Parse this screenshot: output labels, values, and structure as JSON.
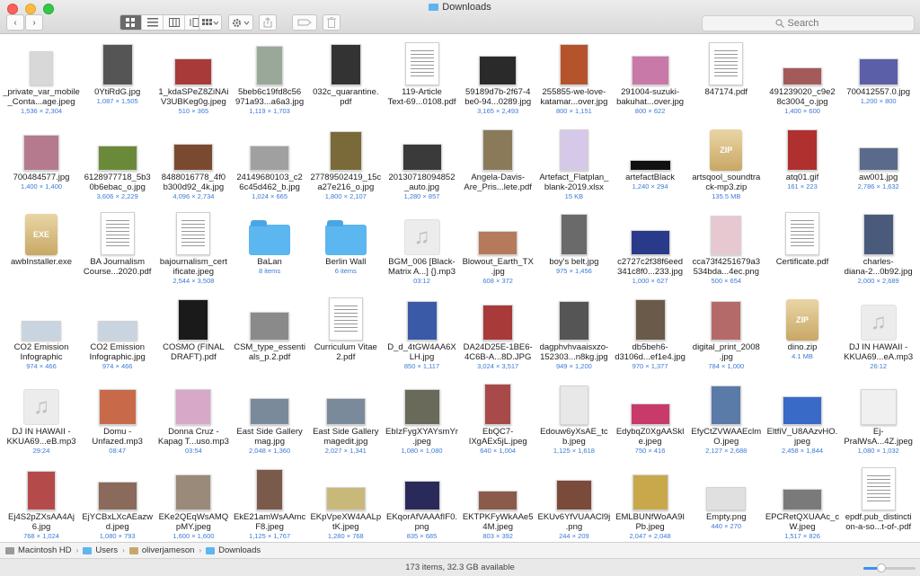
{
  "window": {
    "title": "Downloads",
    "accent": "#5cb6ef"
  },
  "toolbar": {
    "back": "‹",
    "forward": "›",
    "view_modes": [
      "icon-view-icon",
      "list-view-icon",
      "column-view-icon",
      "coverflow-view-icon"
    ],
    "arrange_icon": "grid-arrange-icon",
    "action_icon": "gear-icon",
    "share_icon": "share-icon",
    "tags_icon": "tag-icon",
    "trash_icon": "trash-icon",
    "search_placeholder": "Search"
  },
  "files": [
    {
      "name": "_private_var_mobile\n_Conta...age.jpeg",
      "meta": "1,536 × 2,304",
      "kind": "image",
      "w": 26,
      "h": 38,
      "color": "#d8d8d8"
    },
    {
      "name": "0YtiRdG.jpg",
      "meta": "1,087 × 1,505",
      "kind": "image",
      "w": 34,
      "h": 46,
      "color": "#555555"
    },
    {
      "name": "1_kdaSPeZ8ZiNAi\nV3UBKeg0g.jpeg",
      "meta": "510 × 365",
      "kind": "image",
      "w": 42,
      "h": 30,
      "color": "#a83a3a"
    },
    {
      "name": "5beb6c19fd8c56\n971a93...a6a3.jpg",
      "meta": "1,119 × 1,703",
      "kind": "image",
      "w": 30,
      "h": 44,
      "color": "#9aa89a"
    },
    {
      "name": "032c_quarantine.\npdf",
      "meta": "",
      "kind": "image",
      "w": 34,
      "h": 46,
      "color": "#333333"
    },
    {
      "name": "119-Article\nText-69...0108.pdf",
      "meta": "",
      "kind": "doc"
    },
    {
      "name": "59189d7b-2f67-4\nbe0-94...0289.jpg",
      "meta": "3,165 × 2,493",
      "kind": "image",
      "w": 42,
      "h": 33,
      "color": "#2a2a2a"
    },
    {
      "name": "255855-we-love-\nkatamar...over.jpg",
      "meta": "800 × 1,151",
      "kind": "image",
      "w": 32,
      "h": 46,
      "color": "#b5542c"
    },
    {
      "name": "291004-suzuki-\nbakuhat...over.jpg",
      "meta": "800 × 622",
      "kind": "image",
      "w": 42,
      "h": 33,
      "color": "#c879a8"
    },
    {
      "name": "847174.pdf",
      "meta": "",
      "kind": "doc"
    },
    {
      "name": "491239020_c9e2\n8c3004_o.jpg",
      "meta": "1,400 × 600",
      "kind": "image",
      "w": 44,
      "h": 20,
      "color": "#a55a5a"
    },
    {
      "name": "700412557.0.jpg",
      "meta": "1,200 × 800",
      "kind": "image",
      "w": 44,
      "h": 30,
      "color": "#5a5fa8"
    },
    {
      "name": "700484577.jpg",
      "meta": "1,400 × 1,400",
      "kind": "image",
      "w": 40,
      "h": 40,
      "color": "#b57a8e"
    },
    {
      "name": "6128977718_5b3\n0b6ebac_o.jpg",
      "meta": "3,606 × 2,229",
      "kind": "image",
      "w": 44,
      "h": 28,
      "color": "#6a8a3a"
    },
    {
      "name": "8488016778_4f0\nb300d92_4k.jpg",
      "meta": "4,096 × 2,734",
      "kind": "image",
      "w": 44,
      "h": 30,
      "color": "#7a4a30"
    },
    {
      "name": "24149680103_c2\n6c45d462_b.jpg",
      "meta": "1,024 × 665",
      "kind": "image",
      "w": 44,
      "h": 28,
      "color": "#a0a0a0"
    },
    {
      "name": "27789502419_15c\na27e216_o.jpg",
      "meta": "1,800 × 2,107",
      "kind": "image",
      "w": 36,
      "h": 44,
      "color": "#7a6a3a"
    },
    {
      "name": "20130718094852\n_auto.jpg",
      "meta": "1,280 × 857",
      "kind": "image",
      "w": 44,
      "h": 30,
      "color": "#3a3a3a"
    },
    {
      "name": "Angela-Davis-\nAre_Pris...lete.pdf",
      "meta": "",
      "kind": "image",
      "w": 34,
      "h": 46,
      "color": "#8a7a5a"
    },
    {
      "name": "Artefact_Flatplan_\nblank-2019.xlsx",
      "meta": "15 KB",
      "kind": "image",
      "w": 32,
      "h": 46,
      "color": "#d6c8e8"
    },
    {
      "name": "artefactBlack",
      "meta": "1,240 × 294",
      "kind": "image",
      "w": 46,
      "h": 12,
      "color": "#111111"
    },
    {
      "name": "artsqool_soundtra\nck-mp3.zip",
      "meta": "135.5 MB",
      "kind": "archive",
      "label": "ZIP"
    },
    {
      "name": "atq01.gif",
      "meta": "161 × 223",
      "kind": "image",
      "w": 34,
      "h": 46,
      "color": "#b03030"
    },
    {
      "name": "aw001.jpg",
      "meta": "2,786 × 1,632",
      "kind": "image",
      "w": 44,
      "h": 26,
      "color": "#5a6a8a"
    },
    {
      "name": "awbInstaller.exe",
      "meta": "",
      "kind": "archive",
      "label": "EXE"
    },
    {
      "name": "BA Journalism\nCourse...2020.pdf",
      "meta": "",
      "kind": "doc"
    },
    {
      "name": "bajournalism_cert\nificate.jpeg",
      "meta": "2,544 × 3,508",
      "kind": "doc"
    },
    {
      "name": "BaLan",
      "meta": "8 items",
      "kind": "folder"
    },
    {
      "name": "Berlin Wall",
      "meta": "6 items",
      "kind": "folder"
    },
    {
      "name": "BGM_006 [Black-\nMatrix A...] {}.mp3",
      "meta": "03:12",
      "kind": "audio"
    },
    {
      "name": "Blowout_Earth_TX\n.jpg",
      "meta": "608 × 372",
      "kind": "image",
      "w": 44,
      "h": 27,
      "color": "#b57a5a"
    },
    {
      "name": "boy's belt.jpg",
      "meta": "975 × 1,456",
      "kind": "image",
      "w": 30,
      "h": 46,
      "color": "#6a6a6a"
    },
    {
      "name": "c2727c2f38f6eed\n341c8f0...233.jpg",
      "meta": "1,000 × 627",
      "kind": "image",
      "w": 44,
      "h": 28,
      "color": "#2a3a8a"
    },
    {
      "name": "cca73f4251679a3\n534bda...4ec.png",
      "meta": "500 × 654",
      "kind": "image",
      "w": 34,
      "h": 44,
      "color": "#e8c8d0"
    },
    {
      "name": "Certificate.pdf",
      "meta": "",
      "kind": "doc"
    },
    {
      "name": "charles-\ndiana-2...0b92.jpg",
      "meta": "2,000 × 2,689",
      "kind": "image",
      "w": 34,
      "h": 46,
      "color": "#4a5a7a"
    },
    {
      "name": "CO2 Emission\nInfographic",
      "meta": "974 × 466",
      "kind": "image",
      "w": 44,
      "h": 22,
      "color": "#c8d4e0"
    },
    {
      "name": "CO2 Emission\nInfographic.jpg",
      "meta": "974 × 466",
      "kind": "image",
      "w": 44,
      "h": 22,
      "color": "#c8d4e0"
    },
    {
      "name": "COSMO (FINAL\nDRAFT).pdf",
      "meta": "",
      "kind": "image",
      "w": 34,
      "h": 46,
      "color": "#1a1a1a"
    },
    {
      "name": "CSM_type_essenti\nals_p.2.pdf",
      "meta": "",
      "kind": "image",
      "w": 44,
      "h": 32,
      "color": "#8a8a8a"
    },
    {
      "name": "Curriculum Vitae\n2.pdf",
      "meta": "",
      "kind": "doc"
    },
    {
      "name": "D_d_4tGW4AA6X\nLH.jpg",
      "meta": "850 × 1,117",
      "kind": "image",
      "w": 34,
      "h": 44,
      "color": "#3a5aa8"
    },
    {
      "name": "DA24D25E-1BE6-\n4C6B-A...8D.JPG",
      "meta": "3,024 × 3,517",
      "kind": "image",
      "w": 34,
      "h": 40,
      "color": "#a83a3a"
    },
    {
      "name": "dagphvhvaaisxzo-\n152303...n8kg.jpg",
      "meta": "949 × 1,200",
      "kind": "image",
      "w": 34,
      "h": 44,
      "color": "#555555"
    },
    {
      "name": "db5beh6-\nd3106d...ef1e4.jpg",
      "meta": "970 × 1,377",
      "kind": "image",
      "w": 34,
      "h": 46,
      "color": "#6a5a4a"
    },
    {
      "name": "digital_print_2008\n.jpg",
      "meta": "784 × 1,000",
      "kind": "image",
      "w": 34,
      "h": 44,
      "color": "#b56a6a"
    },
    {
      "name": "dino.zip",
      "meta": "4.1 MB",
      "kind": "archive",
      "label": "ZIP"
    },
    {
      "name": "DJ IN HAWAII -\nKKUA69...eA.mp3",
      "meta": "26:12",
      "kind": "audio"
    },
    {
      "name": "DJ IN HAWAII -\nKKUA69...eB.mp3",
      "meta": "29:24",
      "kind": "audio"
    },
    {
      "name": "Domu -\nUnfazed.mp3",
      "meta": "08:47",
      "kind": "image",
      "w": 42,
      "h": 40,
      "color": "#c86a4a"
    },
    {
      "name": "Donna Cruz -\nKapag T...uso.mp3",
      "meta": "03:54",
      "kind": "image",
      "w": 40,
      "h": 40,
      "color": "#d8a8c8"
    },
    {
      "name": "East Side Gallery\nmag.jpg",
      "meta": "2,048 × 1,360",
      "kind": "image",
      "w": 44,
      "h": 30,
      "color": "#7a8a9a"
    },
    {
      "name": "East Side Gallery\nmagedit.jpg",
      "meta": "2,027 × 1,341",
      "kind": "image",
      "w": 44,
      "h": 30,
      "color": "#7a8a9a"
    },
    {
      "name": "EbIzFygXYAYsmYr\n.jpeg",
      "meta": "1,080 × 1,080",
      "kind": "image",
      "w": 40,
      "h": 40,
      "color": "#6a6a5a"
    },
    {
      "name": "EbQC7-\nIXgAEx5jL.jpeg",
      "meta": "640 × 1,004",
      "kind": "image",
      "w": 30,
      "h": 46,
      "color": "#a84a4a"
    },
    {
      "name": "Edouw6yXsAE_tc\nb.jpeg",
      "meta": "1,125 × 1,618",
      "kind": "image",
      "w": 32,
      "h": 44,
      "color": "#e8e8e8"
    },
    {
      "name": "EdybqZ0XgAASkl\ne.jpeg",
      "meta": "750 × 416",
      "kind": "image",
      "w": 44,
      "h": 24,
      "color": "#c83a6a"
    },
    {
      "name": "EfyCtZVWAAEclm\nO.jpeg",
      "meta": "2,127 × 2,688",
      "kind": "image",
      "w": 34,
      "h": 44,
      "color": "#5a7aa8"
    },
    {
      "name": "EltfiV_U8AAzvHO.\njpeg",
      "meta": "2,458 × 1,844",
      "kind": "image",
      "w": 44,
      "h": 32,
      "color": "#3a6ac8"
    },
    {
      "name": "Ej-\nPralWsA...4Z.jpeg",
      "meta": "1,080 × 1,032",
      "kind": "image",
      "w": 40,
      "h": 40,
      "color": "#f0f0f0"
    },
    {
      "name": "Ej4S2pZXsAA4Aj\n6.jpg",
      "meta": "768 × 1,024",
      "kind": "image",
      "w": 32,
      "h": 44,
      "color": "#b54a4a"
    },
    {
      "name": "EjYCBxLXcAEazw\nd.jpeg",
      "meta": "1,080 × 793",
      "kind": "image",
      "w": 44,
      "h": 32,
      "color": "#8a6a5a"
    },
    {
      "name": "EKe2QEqWsAMQ\npMY.jpeg",
      "meta": "1,600 × 1,600",
      "kind": "image",
      "w": 40,
      "h": 40,
      "color": "#9a8a7a"
    },
    {
      "name": "EkE21amWsAAmc\nF8.jpeg",
      "meta": "1,125 × 1,767",
      "kind": "image",
      "w": 30,
      "h": 46,
      "color": "#7a5a4a"
    },
    {
      "name": "EKpVpeXW4AALp\ntK.jpeg",
      "meta": "1,280 × 768",
      "kind": "image",
      "w": 44,
      "h": 26,
      "color": "#c8b87a"
    },
    {
      "name": "EKqorAfVAAAfIF0.\npng",
      "meta": "835 × 685",
      "kind": "image",
      "w": 40,
      "h": 33,
      "color": "#2a2a5a"
    },
    {
      "name": "EKTPKFyWkAAe5\n4M.jpeg",
      "meta": "803 × 392",
      "kind": "image",
      "w": 44,
      "h": 22,
      "color": "#8a5a4a"
    },
    {
      "name": "EKUv6YfVUAACl9j\n.png",
      "meta": "244 × 209",
      "kind": "image",
      "w": 40,
      "h": 34,
      "color": "#7a4a3a"
    },
    {
      "name": "EMLBUNfWoAA9I\nPb.jpeg",
      "meta": "2,047 × 2,048",
      "kind": "image",
      "w": 40,
      "h": 40,
      "color": "#c8a84a"
    },
    {
      "name": "Empty.png",
      "meta": "440 × 270",
      "kind": "image",
      "w": 44,
      "h": 26,
      "color": "#e0e0e0"
    },
    {
      "name": "EPCRetQXUAAc_c\nW.jpeg",
      "meta": "1,517 × 826",
      "kind": "image",
      "w": 44,
      "h": 24,
      "color": "#7a7a7a"
    },
    {
      "name": "epdf.pub_distincti\non-a-so...t-of-.pdf",
      "meta": "",
      "kind": "doc"
    }
  ],
  "pathbar": {
    "crumbs": [
      "Macintosh HD",
      "Users",
      "oliverjameson",
      "Downloads"
    ]
  },
  "status": {
    "text": "173 items, 32.3 GB available",
    "zoom": 0.35
  }
}
